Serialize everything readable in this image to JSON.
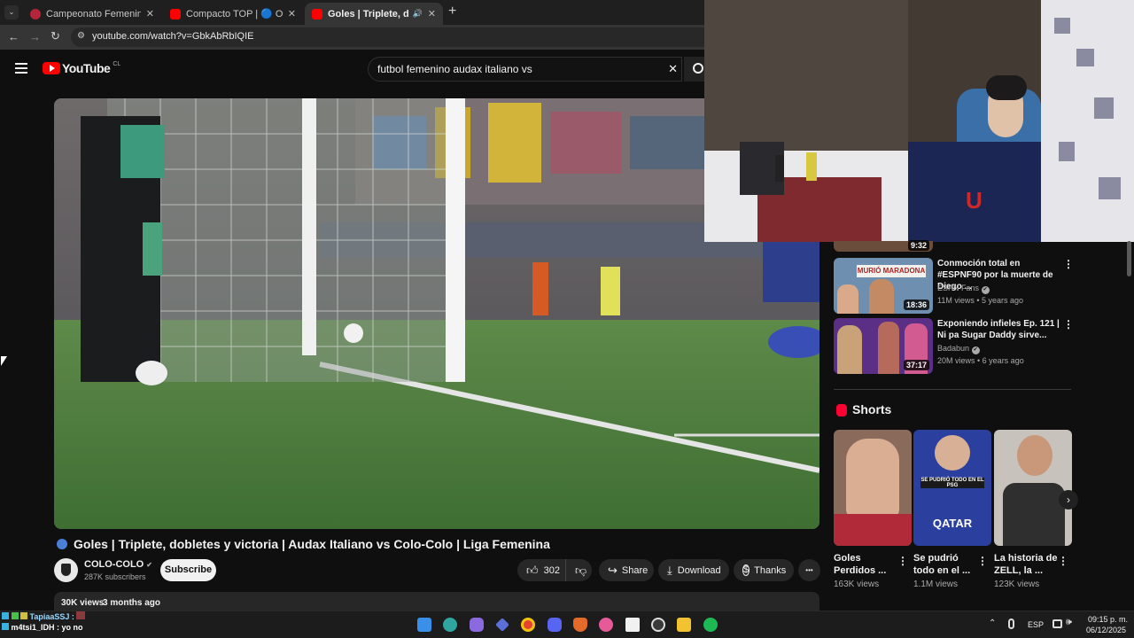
{
  "browser": {
    "tabs": [
      {
        "title": "Campeonato Femenino – Camp",
        "icon": "campeonato-favicon",
        "color": "#b3263b"
      },
      {
        "title": "Compacto TOP | 🔵 O'Higg",
        "icon": "youtube-favicon",
        "color": "#ff0000"
      },
      {
        "title": "Goles | Triplete, doble",
        "icon": "youtube-favicon",
        "color": "#ff0000"
      }
    ],
    "tab_close": "✕",
    "new_tab": "+",
    "url": "youtube.com/watch?v=GbkAbRbIQIE"
  },
  "youtube": {
    "logo_text": "YouTube",
    "region": "CL",
    "search_value": "futbol femenino audax italiano vs",
    "clear": "✕"
  },
  "video": {
    "title": "Goles | Triplete, dobletes y victoria | Audax Italiano vs Colo-Colo | Liga Femenina",
    "channel": "COLO-COLO",
    "subscribers": "287K subscribers",
    "subscribe_label": "Subscribe",
    "likes": "302",
    "share_label": "Share",
    "download_label": "Download",
    "thanks_label": "Thanks",
    "more": "•••",
    "views": "30K views",
    "age": "3 months ago"
  },
  "sidebar": {
    "partial_duration": "9:32",
    "recommendations": [
      {
        "title": "Conmoción total en #ESPNF90 por la muerte de Diego ...",
        "channel": "ESPN Fans",
        "views": "11M views",
        "age": "5 years ago",
        "duration": "18:36",
        "thumb_text": "MURIÓ MARADONA"
      },
      {
        "title": "Exponiendo infieles Ep. 121 | Ni pa Sugar Daddy sirve...",
        "channel": "Badabun",
        "views": "20M views",
        "age": "6 years ago",
        "duration": "37:17",
        "thumb_text": ""
      }
    ],
    "shorts_heading": "Shorts",
    "shorts": [
      {
        "title": "Goles Perdidos ...",
        "views": "163K views",
        "thumb_text": ""
      },
      {
        "title": "Se pudrió todo en el ...",
        "views": "1.1M views",
        "thumb_text": "SE PUDRIÓ TODO EN EL PSG",
        "thumb_text2": "QATAR"
      },
      {
        "title": "La historia de ZELL, la ...",
        "views": "123K views",
        "thumb_text": ""
      }
    ]
  },
  "chat": {
    "user1": "TapiaaSSJ :",
    "user2": "m4tsi1_IDH : yo no"
  },
  "taskbar": {
    "lang": "ESP",
    "time": "09:15 p. m.",
    "date": "06/12/2025"
  }
}
